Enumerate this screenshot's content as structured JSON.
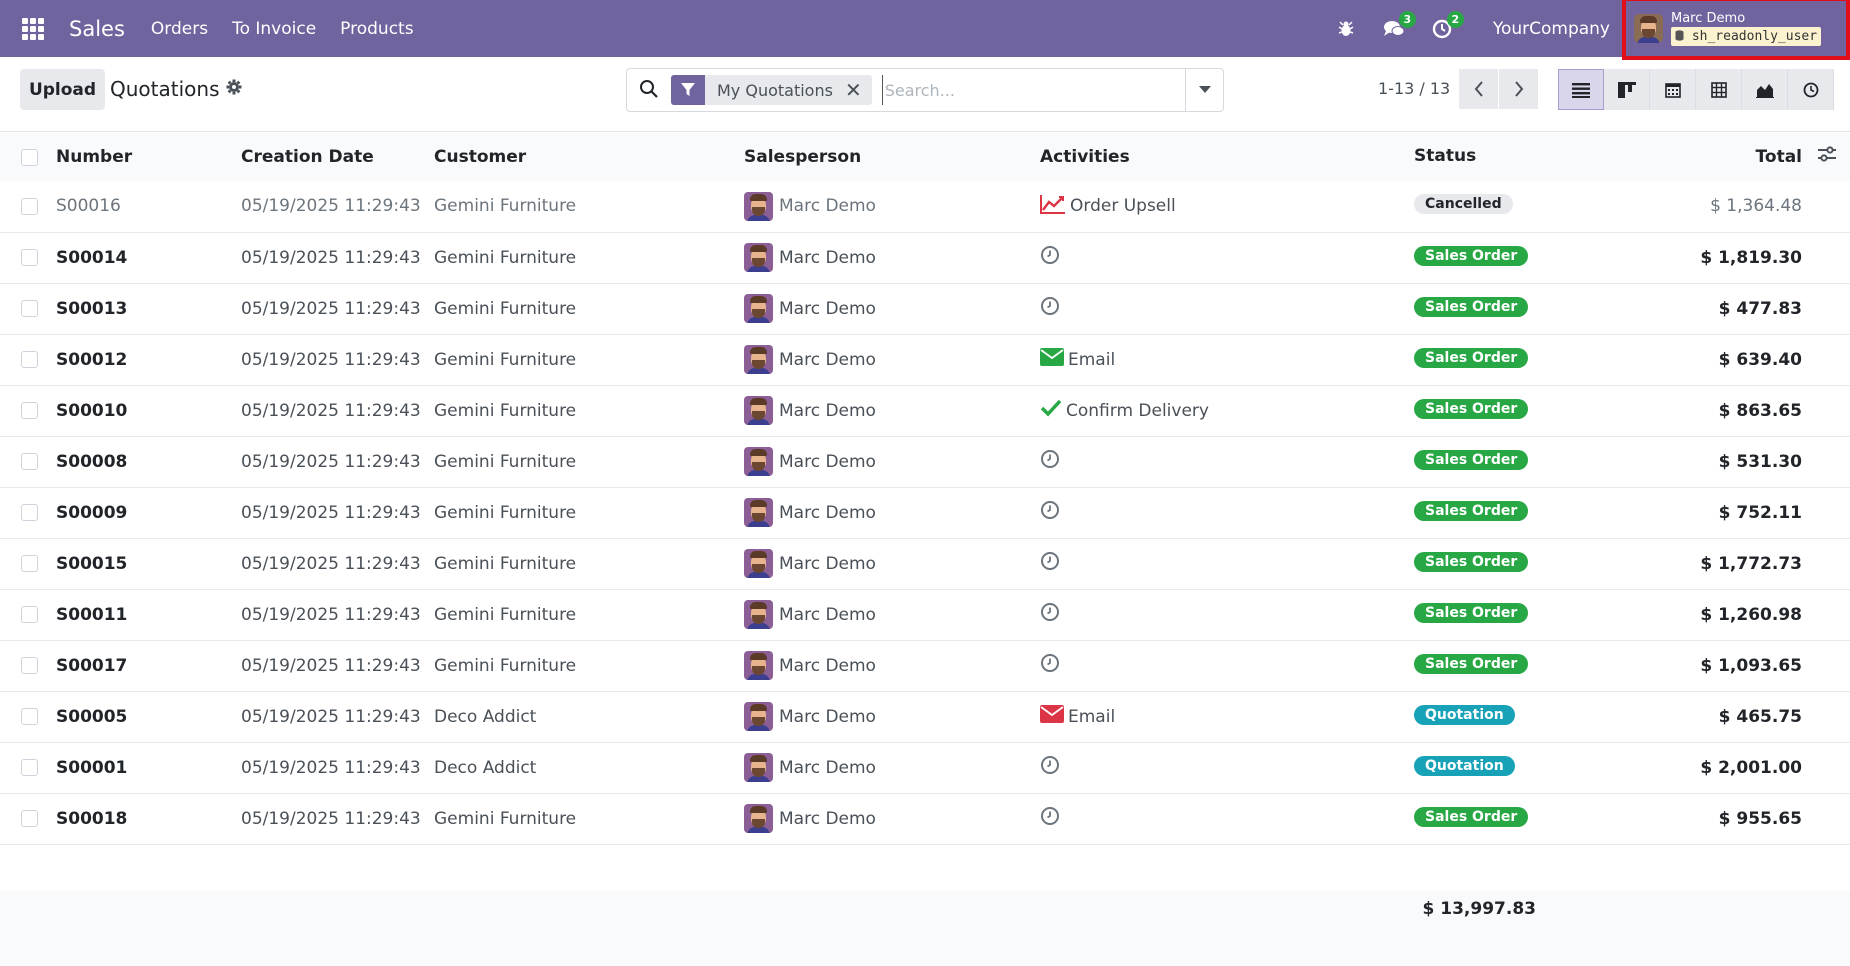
{
  "navbar": {
    "app_name": "Sales",
    "menu": [
      "Orders",
      "To Invoice",
      "Products"
    ],
    "messages_count": "3",
    "activities_count": "2",
    "company": "YourCompany",
    "user_name": "Marc Demo",
    "db_name": "sh_readonly_user"
  },
  "control": {
    "upload_label": "Upload",
    "title": "Quotations",
    "facet_label": "My Quotations",
    "search_placeholder": "Search...",
    "pager": "1-13 / 13"
  },
  "table": {
    "headers": {
      "number": "Number",
      "creation_date": "Creation Date",
      "customer": "Customer",
      "salesperson": "Salesperson",
      "activities": "Activities",
      "total": "Total",
      "status": "Status"
    },
    "rows": [
      {
        "number": "S00016",
        "date": "05/19/2025 11:29:43",
        "customer": "Gemini Furniture",
        "salesperson": "Marc Demo",
        "activity": "Order Upsell",
        "activity_icon": "chart-line-icon",
        "total": "$ 1,364.48",
        "status": "Cancelled"
      },
      {
        "number": "S00014",
        "date": "05/19/2025 11:29:43",
        "customer": "Gemini Furniture",
        "salesperson": "Marc Demo",
        "activity": "",
        "activity_icon": "clock-icon",
        "total": "$ 1,819.30",
        "status": "Sales Order"
      },
      {
        "number": "S00013",
        "date": "05/19/2025 11:29:43",
        "customer": "Gemini Furniture",
        "salesperson": "Marc Demo",
        "activity": "",
        "activity_icon": "clock-icon",
        "total": "$ 477.83",
        "status": "Sales Order"
      },
      {
        "number": "S00012",
        "date": "05/19/2025 11:29:43",
        "customer": "Gemini Furniture",
        "salesperson": "Marc Demo",
        "activity": "Email",
        "activity_icon": "envelope-green-icon",
        "total": "$ 639.40",
        "status": "Sales Order"
      },
      {
        "number": "S00010",
        "date": "05/19/2025 11:29:43",
        "customer": "Gemini Furniture",
        "salesperson": "Marc Demo",
        "activity": "Confirm Delivery",
        "activity_icon": "check-icon",
        "total": "$ 863.65",
        "status": "Sales Order"
      },
      {
        "number": "S00008",
        "date": "05/19/2025 11:29:43",
        "customer": "Gemini Furniture",
        "salesperson": "Marc Demo",
        "activity": "",
        "activity_icon": "clock-icon",
        "total": "$ 531.30",
        "status": "Sales Order"
      },
      {
        "number": "S00009",
        "date": "05/19/2025 11:29:43",
        "customer": "Gemini Furniture",
        "salesperson": "Marc Demo",
        "activity": "",
        "activity_icon": "clock-icon",
        "total": "$ 752.11",
        "status": "Sales Order"
      },
      {
        "number": "S00015",
        "date": "05/19/2025 11:29:43",
        "customer": "Gemini Furniture",
        "salesperson": "Marc Demo",
        "activity": "",
        "activity_icon": "clock-icon",
        "total": "$ 1,772.73",
        "status": "Sales Order"
      },
      {
        "number": "S00011",
        "date": "05/19/2025 11:29:43",
        "customer": "Gemini Furniture",
        "salesperson": "Marc Demo",
        "activity": "",
        "activity_icon": "clock-icon",
        "total": "$ 1,260.98",
        "status": "Sales Order"
      },
      {
        "number": "S00017",
        "date": "05/19/2025 11:29:43",
        "customer": "Gemini Furniture",
        "salesperson": "Marc Demo",
        "activity": "",
        "activity_icon": "clock-icon",
        "total": "$ 1,093.65",
        "status": "Sales Order"
      },
      {
        "number": "S00005",
        "date": "05/19/2025 11:29:43",
        "customer": "Deco Addict",
        "salesperson": "Marc Demo",
        "activity": "Email",
        "activity_icon": "envelope-red-icon",
        "total": "$ 465.75",
        "status": "Quotation"
      },
      {
        "number": "S00001",
        "date": "05/19/2025 11:29:43",
        "customer": "Deco Addict",
        "salesperson": "Marc Demo",
        "activity": "",
        "activity_icon": "clock-icon",
        "total": "$ 2,001.00",
        "status": "Quotation"
      },
      {
        "number": "S00018",
        "date": "05/19/2025 11:29:43",
        "customer": "Gemini Furniture",
        "salesperson": "Marc Demo",
        "activity": "",
        "activity_icon": "clock-icon",
        "total": "$ 955.65",
        "status": "Sales Order"
      }
    ],
    "grand_total": "$ 13,997.83"
  },
  "colors": {
    "navbar": "#71639e",
    "sales_order": "#28a745",
    "quotation": "#17a2b8",
    "cancelled": "#e7e9ed",
    "highlight_border": "#e10f1a"
  }
}
